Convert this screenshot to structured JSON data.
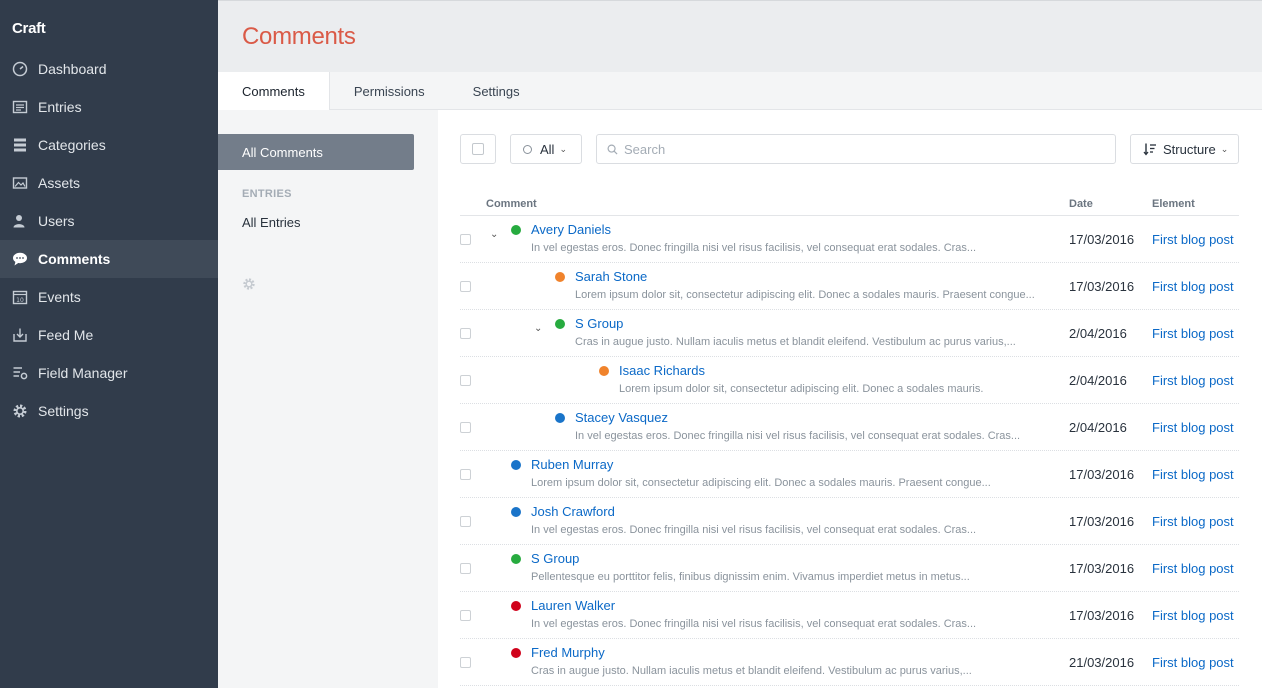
{
  "app": {
    "brand": "Craft"
  },
  "nav": [
    {
      "label": "Dashboard",
      "icon": "dashboard-icon"
    },
    {
      "label": "Entries",
      "icon": "entries-icon"
    },
    {
      "label": "Categories",
      "icon": "categories-icon"
    },
    {
      "label": "Assets",
      "icon": "assets-icon"
    },
    {
      "label": "Users",
      "icon": "users-icon"
    },
    {
      "label": "Comments",
      "icon": "comments-icon",
      "selected": true
    },
    {
      "label": "Events",
      "icon": "events-icon"
    },
    {
      "label": "Feed Me",
      "icon": "feed-me-icon"
    },
    {
      "label": "Field Manager",
      "icon": "field-manager-icon"
    },
    {
      "label": "Settings",
      "icon": "settings-gear-icon"
    }
  ],
  "header": {
    "title": "Comments"
  },
  "tabs": [
    {
      "label": "Comments",
      "selected": true
    },
    {
      "label": "Permissions"
    },
    {
      "label": "Settings"
    }
  ],
  "sources": {
    "all_comments": "All Comments",
    "entries_heading": "ENTRIES",
    "all_entries": "All Entries"
  },
  "toolbar": {
    "status_label": "All",
    "search_placeholder": "Search",
    "sort_label": "Structure"
  },
  "table": {
    "columns": {
      "comment": "Comment",
      "date": "Date",
      "element": "Element"
    },
    "status_colors": {
      "green": "#27ab3f",
      "orange": "#f0832c",
      "blue": "#1a74c9",
      "red": "#d0021b"
    },
    "rows": [
      {
        "name": "Avery Daniels",
        "excerpt": "In vel egestas eros. Donec fringilla nisi vel risus facilisis, vel consequat erat sodales. Cras...",
        "date": "17/03/2016",
        "element": "First blog post",
        "level": 1,
        "status": "green",
        "expander": true
      },
      {
        "name": "Sarah Stone",
        "excerpt": "Lorem ipsum dolor sit, consectetur adipiscing elit. Donec a sodales mauris. Praesent congue...",
        "date": "17/03/2016",
        "element": "First blog post",
        "level": 2,
        "status": "orange",
        "expander": false
      },
      {
        "name": "S Group",
        "excerpt": "Cras in augue justo. Nullam iaculis metus et blandit eleifend. Vestibulum ac purus varius,...",
        "date": "2/04/2016",
        "element": "First blog post",
        "level": 2,
        "status": "green",
        "expander": true
      },
      {
        "name": "Isaac Richards",
        "excerpt": "Lorem ipsum dolor sit, consectetur adipiscing elit. Donec a sodales mauris.",
        "date": "2/04/2016",
        "element": "First blog post",
        "level": 3,
        "status": "orange",
        "expander": false
      },
      {
        "name": "Stacey Vasquez",
        "excerpt": "In vel egestas eros. Donec fringilla nisi vel risus facilisis, vel consequat erat sodales. Cras...",
        "date": "2/04/2016",
        "element": "First blog post",
        "level": 2,
        "status": "blue",
        "expander": false
      },
      {
        "name": "Ruben Murray",
        "excerpt": "Lorem ipsum dolor sit, consectetur adipiscing elit. Donec a sodales mauris. Praesent congue...",
        "date": "17/03/2016",
        "element": "First blog post",
        "level": 1,
        "status": "blue",
        "expander": false
      },
      {
        "name": "Josh Crawford",
        "excerpt": "In vel egestas eros. Donec fringilla nisi vel risus facilisis, vel consequat erat sodales. Cras...",
        "date": "17/03/2016",
        "element": "First blog post",
        "level": 1,
        "status": "blue",
        "expander": false
      },
      {
        "name": "S Group",
        "excerpt": "Pellentesque eu porttitor felis, finibus dignissim enim. Vivamus imperdiet metus in metus...",
        "date": "17/03/2016",
        "element": "First blog post",
        "level": 1,
        "status": "green",
        "expander": false
      },
      {
        "name": "Lauren Walker",
        "excerpt": "In vel egestas eros. Donec fringilla nisi vel risus facilisis, vel consequat erat sodales. Cras...",
        "date": "17/03/2016",
        "element": "First blog post",
        "level": 1,
        "status": "red",
        "expander": false
      },
      {
        "name": "Fred Murphy",
        "excerpt": "Cras in augue justo. Nullam iaculis metus et blandit eleifend. Vestibulum ac purus varius,...",
        "date": "21/03/2016",
        "element": "First blog post",
        "level": 1,
        "status": "red",
        "expander": false
      }
    ]
  }
}
